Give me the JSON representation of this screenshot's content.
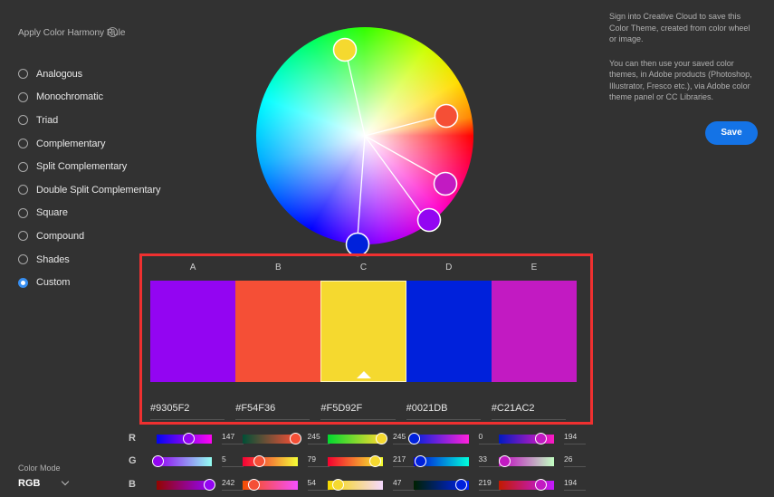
{
  "harmony": {
    "title": "Apply Color Harmony Rule",
    "help_icon": "question-circle-icon",
    "rules": [
      {
        "label": "Analogous",
        "checked": false
      },
      {
        "label": "Monochromatic",
        "checked": false
      },
      {
        "label": "Triad",
        "checked": false
      },
      {
        "label": "Complementary",
        "checked": false
      },
      {
        "label": "Split Complementary",
        "checked": false
      },
      {
        "label": "Double Split Complementary",
        "checked": false
      },
      {
        "label": "Square",
        "checked": false
      },
      {
        "label": "Compound",
        "checked": false
      },
      {
        "label": "Shades",
        "checked": false
      },
      {
        "label": "Custom",
        "checked": true
      }
    ]
  },
  "info": {
    "paragraph1": "Sign into Creative Cloud to save this Color Theme, created from color wheel or image.",
    "paragraph2": "You can then use your saved color themes, in Adobe products (Photoshop, Illustrator, Fresco etc.), via Adobe color theme panel or CC Libraries.",
    "save_label": "Save"
  },
  "theme": {
    "selected_index": 2,
    "swatches": [
      {
        "label": "A",
        "hex": "#9305F2",
        "r": 147,
        "g": 5,
        "b": 242
      },
      {
        "label": "B",
        "hex": "#F54F36",
        "r": 245,
        "g": 79,
        "b": 54
      },
      {
        "label": "C",
        "hex": "#F5D92F",
        "r": 245,
        "g": 217,
        "b": 47
      },
      {
        "label": "D",
        "hex": "#0021DB",
        "r": 0,
        "g": 33,
        "b": 219
      },
      {
        "label": "E",
        "hex": "#C21AC2",
        "r": 194,
        "g": 26,
        "b": 194
      }
    ]
  },
  "channels": {
    "r": "R",
    "g": "G",
    "b": "B"
  },
  "color_mode": {
    "label": "Color Mode",
    "value": "RGB"
  },
  "colors": {
    "accent": "#1473e6",
    "highlight_border": "#ef3030",
    "background": "#323232"
  }
}
